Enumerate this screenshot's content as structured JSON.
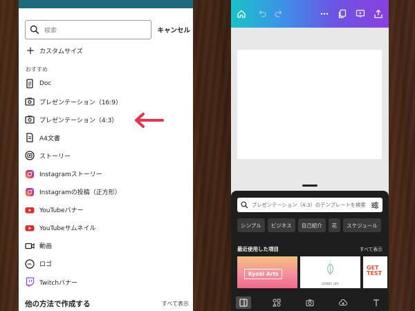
{
  "left_panel": {
    "search_placeholder": "検索",
    "cancel_label": "キャンセル",
    "custom_size_label": "カスタムサイズ",
    "section_label": "おすすめ",
    "items": [
      {
        "label": "Doc",
        "icon": "doc-icon"
      },
      {
        "label": "プレゼンテーション（16:9）",
        "icon": "presentation-icon"
      },
      {
        "label": "プレゼンテーション（4:3）",
        "icon": "presentation-icon"
      },
      {
        "label": "A4文書",
        "icon": "document-icon"
      },
      {
        "label": "ストーリー",
        "icon": "story-icon"
      },
      {
        "label": "Instagramストーリー",
        "icon": "instagram-icon"
      },
      {
        "label": "Instagramの投稿（正方形）",
        "icon": "instagram-icon"
      },
      {
        "label": "YouTubeバナー",
        "icon": "youtube-icon"
      },
      {
        "label": "YouTubeサムネイル",
        "icon": "youtube-icon"
      },
      {
        "label": "動画",
        "icon": "video-icon"
      },
      {
        "label": "ロゴ",
        "icon": "logo-icon"
      },
      {
        "label": "Twitchバナー",
        "icon": "twitch-icon"
      }
    ],
    "other_heading": "他の方法で作成する",
    "see_all": "すべて表示"
  },
  "right_panel": {
    "search_text": "プレゼンテーション（4:3）のテンプレートを検索",
    "chips": [
      "シンプル",
      "ビジネス",
      "自己紹介",
      "花",
      "スケジュール"
    ],
    "recent_heading": "最近使用した項目",
    "see_all": "すべて表示",
    "thumbs": {
      "kyobi": "Kyobi Arts",
      "loving": "LOVING LIFE",
      "gettest": "GET TEST"
    }
  },
  "colors": {
    "arrow": "#e8334a",
    "youtube": "#e32b2b",
    "twitch": "#9146ff",
    "instagram": "#e1306c"
  }
}
